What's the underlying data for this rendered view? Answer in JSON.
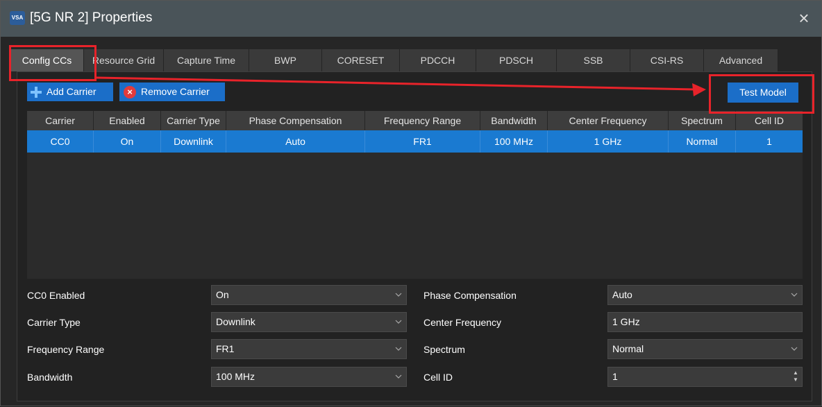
{
  "window": {
    "app_icon": "VSA",
    "title": "[5G NR 2] Properties",
    "close_glyph": "×"
  },
  "tabs": [
    {
      "label": "Config CCs",
      "active": true
    },
    {
      "label": "Resource Grid"
    },
    {
      "label": "Capture Time"
    },
    {
      "label": "BWP"
    },
    {
      "label": "CORESET"
    },
    {
      "label": "PDCCH"
    },
    {
      "label": "PDSCH"
    },
    {
      "label": "SSB"
    },
    {
      "label": "CSI-RS"
    },
    {
      "label": "Advanced"
    }
  ],
  "toolbar": {
    "add_carrier": "Add Carrier",
    "remove_carrier": "Remove Carrier",
    "test_model": "Test Model"
  },
  "table": {
    "columns": [
      "Carrier",
      "Enabled",
      "Carrier Type",
      "Phase Compensation",
      "Frequency Range",
      "Bandwidth",
      "Center Frequency",
      "Spectrum",
      "Cell ID"
    ],
    "rows": [
      [
        "CC0",
        "On",
        "Downlink",
        "Auto",
        "FR1",
        "100 MHz",
        "1 GHz",
        "Normal",
        "1"
      ]
    ]
  },
  "form": {
    "cc0_enabled_label": "CC0 Enabled",
    "cc0_enabled_value": "On",
    "carrier_type_label": "Carrier Type",
    "carrier_type_value": "Downlink",
    "frequency_range_label": "Frequency Range",
    "frequency_range_value": "FR1",
    "bandwidth_label": "Bandwidth",
    "bandwidth_value": "100 MHz",
    "phase_comp_label": "Phase Compensation",
    "phase_comp_value": "Auto",
    "center_freq_label": "Center Frequency",
    "center_freq_value": "1 GHz",
    "spectrum_label": "Spectrum",
    "spectrum_value": "Normal",
    "cell_id_label": "Cell ID",
    "cell_id_value": "1"
  },
  "colors": {
    "accent": "#1b6ec8",
    "selected_row": "#1a7ad1",
    "annotation": "#e8232a",
    "titlebar": "#4a5459"
  }
}
